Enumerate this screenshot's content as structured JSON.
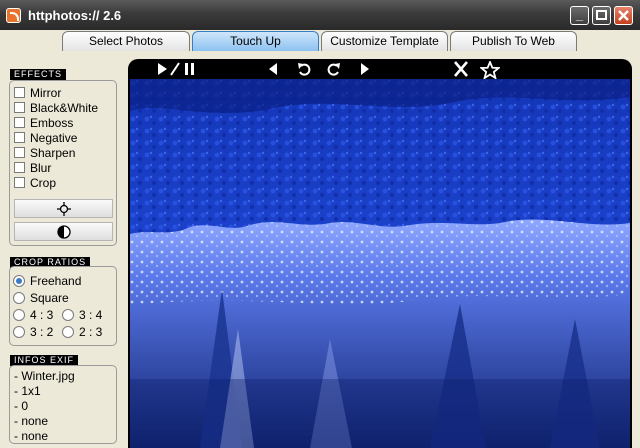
{
  "window": {
    "title": "httphotos:// 2.6"
  },
  "tabs": [
    "Select Photos",
    "Touch Up",
    "Customize Template",
    "Publish To Web"
  ],
  "active_tab": "Touch Up",
  "effects": {
    "label": "EFFECTS",
    "items": [
      "Mirror",
      "Black&White",
      "Emboss",
      "Negative",
      "Sharpen",
      "Blur",
      "Crop"
    ]
  },
  "crop_ratios": {
    "label": "CROP RATIOS",
    "freehand": "Freehand",
    "square": "Square",
    "r43": "4 : 3",
    "r34": "3 : 4",
    "r32": "3 : 2",
    "r23": "2 : 3",
    "selected": "Freehand"
  },
  "exif": {
    "label": "INFOS EXIF",
    "lines": [
      "- Winter.jpg",
      "- 1x1",
      "- 0",
      "- none",
      "- none"
    ]
  },
  "viewer_toolbar": {
    "icons": [
      "play-icon",
      "separator-icon",
      "pause-icon",
      "previous-icon",
      "rotate-left-icon",
      "rotate-right-icon",
      "next-icon",
      "delete-icon",
      "favorite-star-icon"
    ]
  },
  "colors": {
    "tab_active": "#8cc2f0",
    "titlebar": "#3a3a3a",
    "close_button": "#c2401e",
    "photo_blue": "#1d3fc2"
  }
}
